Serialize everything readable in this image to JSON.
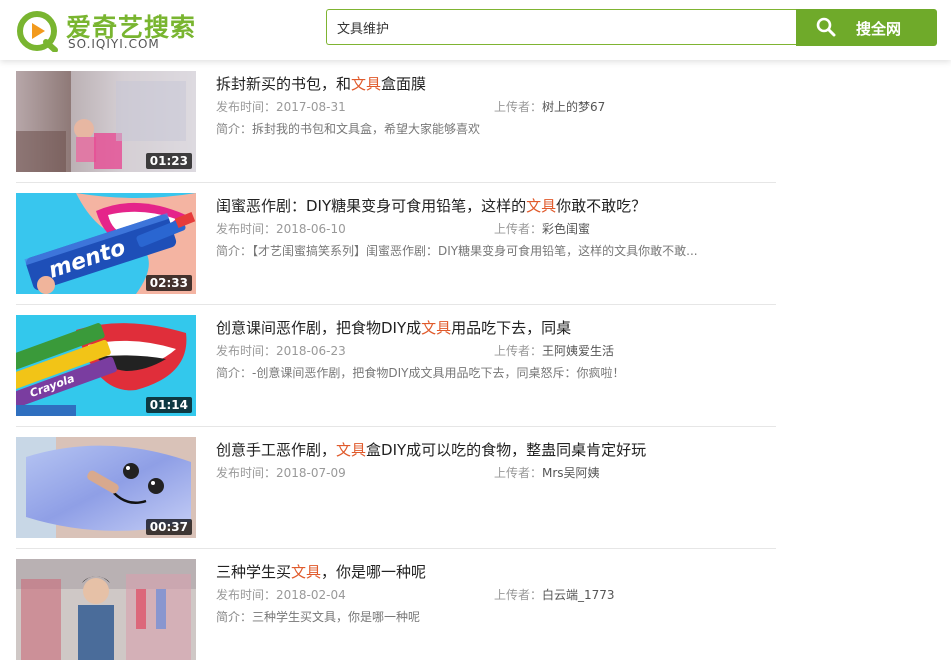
{
  "header": {
    "logo_text": "爱奇艺搜索",
    "logo_sub": "SO.IQIYI.COM",
    "search_value": "文具维护",
    "search_button_label": "搜全网",
    "brand_color": "#6faa2a"
  },
  "labels": {
    "date_prefix": "发布时间：",
    "uploader_prefix": "上传者：",
    "desc_prefix": "简介："
  },
  "results": [
    {
      "title_before": "拆封新买的书包，和",
      "title_highlight": "文具",
      "title_after": "盒面膜",
      "date": "2017-08-31",
      "uploader": "树上的梦67",
      "desc": "拆封我的书包和文具盒，希望大家能够喜欢",
      "duration": "01:23"
    },
    {
      "title_before": "闺蜜恶作剧：DIY糖果变身可食用铅笔，这样的",
      "title_highlight": "文具",
      "title_after": "你敢不敢吃？",
      "date": "2018-06-10",
      "uploader": "彩色闺蜜",
      "desc": "【才艺闺蜜搞笑系列】闺蜜恶作剧：DIY糖果变身可食用铅笔，这样的文具你敢不敢...",
      "duration": "02:33",
      "thumb_text": "mento"
    },
    {
      "title_before": "创意课间恶作剧，把食物DIY成",
      "title_highlight": "文具",
      "title_after": "用品吃下去，同桌",
      "date": "2018-06-23",
      "uploader": "王阿姨爱生活",
      "desc": "-创意课间恶作剧，把食物DIY成文具用品吃下去，同桌怒斥：你疯啦！",
      "duration": "01:14",
      "thumb_text": "Crayola"
    },
    {
      "title_before": "创意手工恶作剧，",
      "title_highlight": "文具",
      "title_after": "盒DIY成可以吃的食物，整蛊同桌肯定好玩",
      "date": "2018-07-09",
      "uploader": "Mrs吴阿姨",
      "desc": "",
      "duration": "00:37"
    },
    {
      "title_before": "三种学生买",
      "title_highlight": "文具",
      "title_after": "，你是哪一种呢",
      "date": "2018-02-04",
      "uploader": "白云端_1773",
      "desc": "三种学生买文具，你是哪一种呢",
      "duration": ""
    }
  ]
}
